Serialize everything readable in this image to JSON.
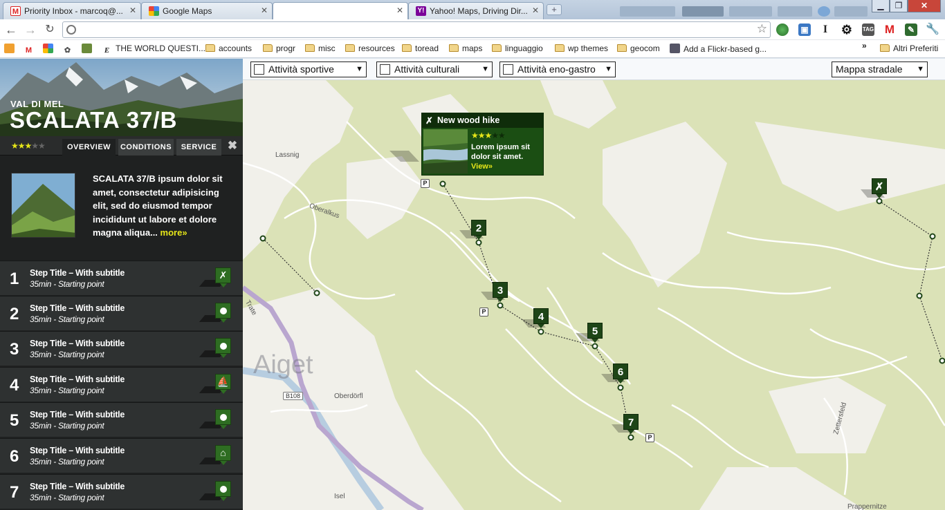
{
  "browser": {
    "tabs": [
      {
        "title": "Priority Inbox - marcoq@...",
        "icon": "gmail-icon"
      },
      {
        "title": "Google Maps",
        "icon": "google-maps-icon"
      },
      {
        "title": "",
        "icon": ""
      },
      {
        "title": "Yahoo! Maps, Driving Dir...",
        "icon": "yahoo-icon"
      }
    ],
    "new_tab_label": "+",
    "address": "",
    "bookmarks": [
      {
        "label": "THE WORLD QUESTI...",
        "type": "site"
      },
      {
        "label": "accounts",
        "type": "folder"
      },
      {
        "label": "progr",
        "type": "folder"
      },
      {
        "label": "misc",
        "type": "folder"
      },
      {
        "label": "resources",
        "type": "folder"
      },
      {
        "label": "toread",
        "type": "folder"
      },
      {
        "label": "maps",
        "type": "folder"
      },
      {
        "label": "linguaggio",
        "type": "folder"
      },
      {
        "label": "wp themes",
        "type": "folder"
      },
      {
        "label": "geocom",
        "type": "folder"
      },
      {
        "label": "Add a Flickr-based g...",
        "type": "site"
      }
    ],
    "bookmarks_overflow": "»",
    "other_bookmarks": "Altri Preferiti"
  },
  "sidebar": {
    "subtitle": "VAL DI MEL",
    "title": "SCALATA 37/B",
    "rating": 3,
    "rating_max": 5,
    "tabs": [
      "OVERVIEW",
      "CONDITIONS",
      "SERVICE"
    ],
    "active_tab": "OVERVIEW",
    "close_label": "✖",
    "overview_text": "SCALATA 37/B ipsum dolor sit amet, consectetur adipisicing elit, sed do eiusmod tempor incididunt ut labore et dolore magna aliqua...",
    "more_label": "more»",
    "steps": [
      {
        "num": "1",
        "title": "Step Title – With subtitle",
        "subtitle": "35min - Starting point",
        "icon": "hiker-icon"
      },
      {
        "num": "2",
        "title": "Step Title – With subtitle",
        "subtitle": "35min - Starting point",
        "icon": "dot-icon"
      },
      {
        "num": "3",
        "title": "Step Title – With subtitle",
        "subtitle": "35min - Starting point",
        "icon": "dot-icon"
      },
      {
        "num": "4",
        "title": "Step Title – With subtitle",
        "subtitle": "35min - Starting point",
        "icon": "canoe-icon"
      },
      {
        "num": "5",
        "title": "Step Title – With subtitle",
        "subtitle": "35min - Starting point",
        "icon": "dot-icon"
      },
      {
        "num": "6",
        "title": "Step Title – With subtitle",
        "subtitle": "35min - Starting point",
        "icon": "shelter-icon"
      },
      {
        "num": "7",
        "title": "Step Title – With subtitle",
        "subtitle": "35min - Starting point",
        "icon": "dot-icon"
      }
    ]
  },
  "map": {
    "filters": [
      {
        "label": "Attività sportive",
        "checked": false
      },
      {
        "label": "Attività culturali",
        "checked": false
      },
      {
        "label": "Attività eno-gastro",
        "checked": false
      }
    ],
    "map_type": "Mappa stradale",
    "markers": [
      "2",
      "3",
      "4",
      "5",
      "6",
      "7"
    ],
    "parking_label": "P",
    "place_labels": [
      "Lassnig",
      "Oberalkus",
      "Aiget",
      "Oberdörfl",
      "Trate",
      "Zettersfeld",
      "Isel",
      "Prappernitze"
    ],
    "road_label": "B108",
    "popup": {
      "title": "New wood hike",
      "rating": 3,
      "text": "Lorem ipsum sit dolor sit amet.",
      "view_label": "View»"
    }
  },
  "colors": {
    "map_land": "#dbe2b7",
    "marker_green": "#1e4517",
    "star_yellow": "#e6e619",
    "sidebar_bg": "#1f2121"
  }
}
